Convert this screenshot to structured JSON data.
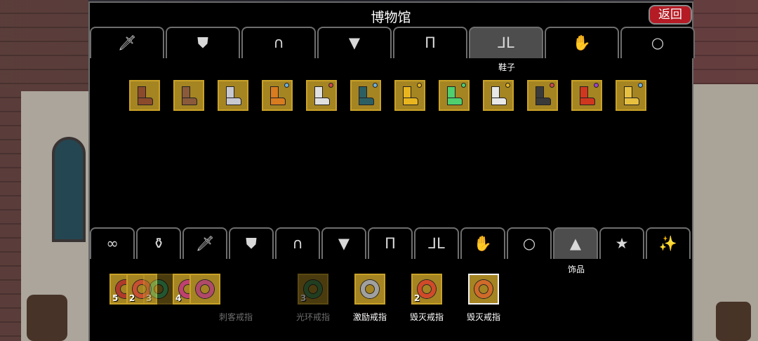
{
  "window": {
    "title": "博物馆",
    "back_label": "返回"
  },
  "top_tabs": {
    "active_index": 5,
    "active_caption": "鞋子",
    "items": [
      {
        "icon": "sword-icon",
        "glyph": "🗡"
      },
      {
        "icon": "shield-icon",
        "glyph": "⛊"
      },
      {
        "icon": "helmet-icon",
        "glyph": "∩"
      },
      {
        "icon": "armor-icon",
        "glyph": "▼"
      },
      {
        "icon": "pants-icon",
        "glyph": "Π"
      },
      {
        "icon": "boots-icon",
        "glyph": "⅃L"
      },
      {
        "icon": "gloves-icon",
        "glyph": "✋"
      },
      {
        "icon": "ring-icon",
        "glyph": "○"
      }
    ]
  },
  "boots": [
    {
      "color": "#8b4a2b"
    },
    {
      "color": "#8a5a3a"
    },
    {
      "color": "#c8c8d0"
    },
    {
      "color": "#d97b1f",
      "gem": "#6fb3e0"
    },
    {
      "color": "#e0e0e0",
      "gem": "#d04a4a"
    },
    {
      "color": "#2c5f64",
      "gem": "#6fb3e0"
    },
    {
      "color": "#e8b51e",
      "gem": "#e8b51e"
    },
    {
      "color": "#4fcf6f",
      "gem": "#4fcf6f"
    },
    {
      "color": "#e8e8e8",
      "gem": "#e8b51e"
    },
    {
      "color": "#3a3a3a",
      "gem": "#d04a4a"
    },
    {
      "color": "#d0371f",
      "gem": "#a040d0"
    },
    {
      "color": "#e8c040",
      "gem": "#6fb3e0"
    }
  ],
  "bottom_tabs": {
    "active_index": 10,
    "active_caption": "饰品",
    "items": [
      {
        "icon": "infinity-icon",
        "glyph": "∞"
      },
      {
        "icon": "potion-icon",
        "glyph": "⚱"
      },
      {
        "icon": "sword-icon",
        "glyph": "🗡"
      },
      {
        "icon": "shield-icon",
        "glyph": "⛊"
      },
      {
        "icon": "helmet-icon",
        "glyph": "∩"
      },
      {
        "icon": "armor-icon",
        "glyph": "▼"
      },
      {
        "icon": "pants-icon",
        "glyph": "Π"
      },
      {
        "icon": "boots-icon",
        "glyph": "⅃L"
      },
      {
        "icon": "gloves-icon",
        "glyph": "✋"
      },
      {
        "icon": "ring-icon",
        "glyph": "○"
      },
      {
        "icon": "pile-icon",
        "glyph": "▲"
      },
      {
        "icon": "star-icon",
        "glyph": "★"
      },
      {
        "icon": "wand-icon",
        "glyph": "✨"
      }
    ]
  },
  "rings": [
    {
      "label": "刺客戒指",
      "stack": [
        {
          "count": "5",
          "color": "#b03a2a",
          "dim": false
        },
        {
          "count": "2",
          "color": "#c85030",
          "dim": false
        },
        {
          "count": "3",
          "color": "#4fc06a",
          "dim": true
        },
        {
          "count": "4",
          "color": "#c04070",
          "dim": false
        },
        {
          "count": "",
          "color": "#b04a6a",
          "dim": false
        }
      ],
      "dim": true
    },
    {
      "label": "光环戒指",
      "count": "3",
      "color": "#4a8a4a",
      "dim": true,
      "selected": false
    },
    {
      "label": "激励戒指",
      "count": "",
      "color": "#a0a0a0",
      "dim": false,
      "selected": false
    },
    {
      "label": "毁灭戒指",
      "count": "2",
      "color": "#d04a2a",
      "dim": false,
      "selected": false
    },
    {
      "label": "毁灭戒指",
      "count": "",
      "color": "#d06a2a",
      "dim": false,
      "selected": true
    }
  ]
}
